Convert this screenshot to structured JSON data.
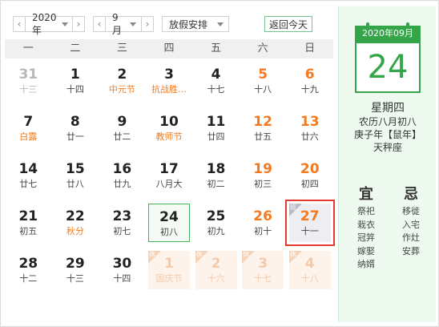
{
  "toolbar": {
    "year": "2020年",
    "month": "9月",
    "holiday": "放假安排",
    "today_btn": "返回今天",
    "prev_icon": "chevron-left-icon",
    "next_icon": "chevron-right-icon"
  },
  "weekdays": [
    "一",
    "二",
    "三",
    "四",
    "五",
    "六",
    "日"
  ],
  "days": [
    {
      "num": "31",
      "sub": "十三",
      "kind": "other"
    },
    {
      "num": "1",
      "sub": "十四"
    },
    {
      "num": "2",
      "sub": "中元节",
      "festival": true
    },
    {
      "num": "3",
      "sub": "抗战胜…",
      "festival": true
    },
    {
      "num": "4",
      "sub": "十七"
    },
    {
      "num": "5",
      "sub": "十八",
      "weekend": true
    },
    {
      "num": "6",
      "sub": "十九",
      "weekend": true
    },
    {
      "num": "7",
      "sub": "白露",
      "festival": true
    },
    {
      "num": "8",
      "sub": "廿一"
    },
    {
      "num": "9",
      "sub": "廿二"
    },
    {
      "num": "10",
      "sub": "教师节",
      "festival": true
    },
    {
      "num": "11",
      "sub": "廿四"
    },
    {
      "num": "12",
      "sub": "廿五",
      "weekend": true
    },
    {
      "num": "13",
      "sub": "廿六",
      "weekend": true
    },
    {
      "num": "14",
      "sub": "廿七"
    },
    {
      "num": "15",
      "sub": "廿八"
    },
    {
      "num": "16",
      "sub": "廿九"
    },
    {
      "num": "17",
      "sub": "八月大"
    },
    {
      "num": "18",
      "sub": "初二"
    },
    {
      "num": "19",
      "sub": "初三",
      "weekend": true
    },
    {
      "num": "20",
      "sub": "初四",
      "weekend": true
    },
    {
      "num": "21",
      "sub": "初五"
    },
    {
      "num": "22",
      "sub": "秋分",
      "festival": true
    },
    {
      "num": "23",
      "sub": "初七"
    },
    {
      "num": "24",
      "sub": "初八",
      "kind": "selected"
    },
    {
      "num": "25",
      "sub": "初九"
    },
    {
      "num": "26",
      "sub": "初十",
      "weekend": true
    },
    {
      "num": "27",
      "sub": "十一",
      "kind": "today",
      "badge": "班"
    },
    {
      "num": "28",
      "sub": "十二"
    },
    {
      "num": "29",
      "sub": "十三"
    },
    {
      "num": "30",
      "sub": "十四"
    },
    {
      "num": "1",
      "sub": "国庆节",
      "kind": "other-holiday",
      "badge": "休"
    },
    {
      "num": "2",
      "sub": "十六",
      "kind": "other-holiday",
      "badge": "休"
    },
    {
      "num": "3",
      "sub": "十七",
      "kind": "other-holiday",
      "badge": "休"
    },
    {
      "num": "4",
      "sub": "十八",
      "kind": "other-holiday",
      "badge": "休"
    }
  ],
  "detail": {
    "header": "2020年09月",
    "day": "24",
    "weekday": "星期四",
    "lunar": "农历八月初八",
    "ganzhi": "庚子年【鼠年】",
    "zodiac": "天秤座",
    "yi_title": "宜",
    "ji_title": "忌",
    "yi": [
      "祭祀",
      "栽衣",
      "冠笄",
      "嫁娶",
      "纳婿"
    ],
    "ji": [
      "移徙",
      "入宅",
      "作灶",
      "安葬"
    ]
  },
  "colors": {
    "accent": "#35a54a",
    "weekend": "#f37a20",
    "today_outline": "#e23b2e",
    "panel_bg": "#eefaf0"
  }
}
